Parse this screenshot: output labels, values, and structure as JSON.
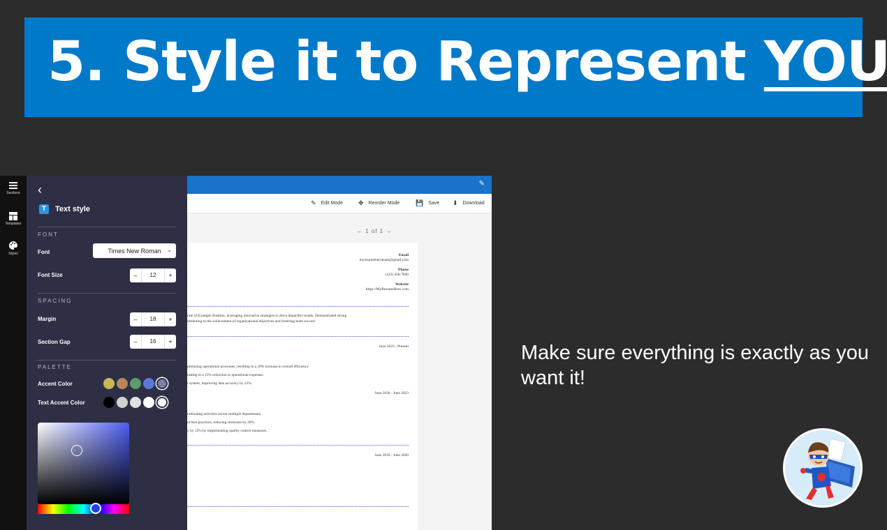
{
  "banner": {
    "title_prefix": "5. Style it to Represent ",
    "title_emphasis": "YOU"
  },
  "rail": {
    "items": [
      {
        "label": "Sections",
        "icon": "menu-icon"
      },
      {
        "label": "Templates",
        "icon": "template-icon"
      },
      {
        "label": "Styles",
        "icon": "palette-icon"
      }
    ]
  },
  "panel": {
    "title": "Text style",
    "font_section": "FONT",
    "font_label": "Font",
    "font_value": "Times New Roman",
    "font_size_label": "Font Size",
    "font_size_value": "12",
    "spacing_section": "SPACING",
    "margin_label": "Margin",
    "margin_value": "18",
    "section_gap_label": "Section Gap",
    "section_gap_value": "16",
    "palette_section": "PALETTE",
    "accent_label": "Accent Color",
    "text_accent_label": "Text Accent Color",
    "accent_colors": [
      "#c7b75a",
      "#b8865a",
      "#5f9b6b",
      "#5a78d6",
      "#7b80a8"
    ],
    "text_accent_colors": [
      "#000000",
      "#d0d0d0",
      "#e0e0e0",
      "#ffffff",
      "#ffffff"
    ],
    "minus": "–",
    "plus": "+"
  },
  "toolbar": {
    "edit_mode": "Edit Mode",
    "reorder_mode": "Reorder Mode",
    "save": "Save",
    "download": "Download"
  },
  "pager": {
    "text": "←  1  of  1  →"
  },
  "resume": {
    "email_label": "Email",
    "email_value": "myresumeheroteam@gmail.com",
    "phone_label": "Phone",
    "phone_value": "(123) 456-7890",
    "website_label": "Website",
    "website_value": "https://MyResumeHero.com",
    "summary_1": "role of Example Position, leveraging innovative strategies to drive impactful results. Demonstrated strong",
    "summary_2": "ntributing to the achievement of organizational objectives and fostering team success",
    "job1_dates": "June 2023 - Present",
    "job1_b1": "ptimizing operational processes, resulting in a 20% increase in overall efficiency.",
    "job1_b2": "eading to a 15% reduction in operational expenses.",
    "job1_b3": "t system, improving data accuracy by 25%.",
    "job2_dates": "June 2020 - June 2023",
    "job2_b1": "ordinating activities across multiple departments.",
    "job2_b2": "nt best practices, reducing stockouts by 20%.",
    "job2_b3": "y by 15% by implementing quality control measures.",
    "job3_dates": "June 2016 - June 2020"
  },
  "caption": "Make sure everything is exactly as you want it!"
}
